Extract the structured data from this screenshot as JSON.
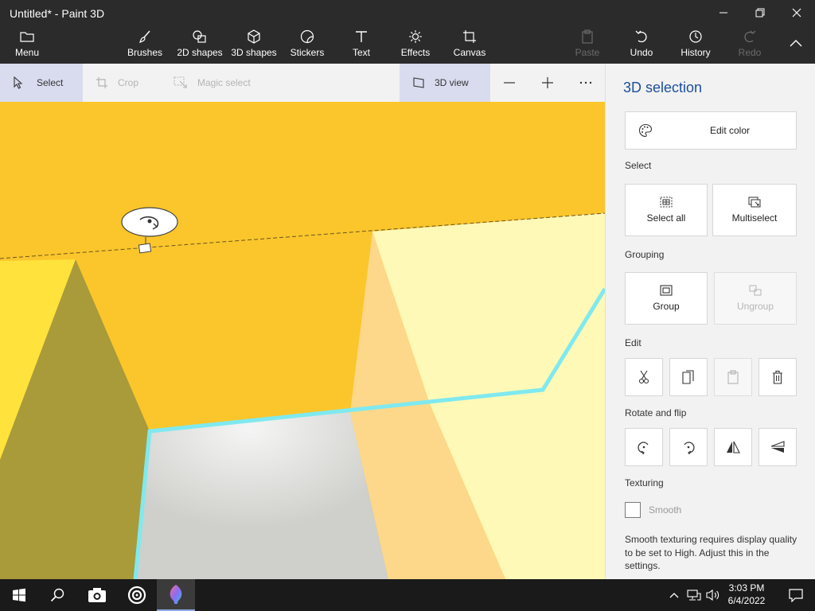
{
  "app": {
    "title": "Untitled* - Paint 3D"
  },
  "ribbon": {
    "menu": "Menu",
    "items": [
      "Brushes",
      "2D shapes",
      "3D shapes",
      "Stickers",
      "Text",
      "Effects",
      "Canvas"
    ],
    "right": [
      "Paste",
      "Undo",
      "History",
      "Redo"
    ]
  },
  "toolbar": {
    "select": "Select",
    "crop": "Crop",
    "magic_select": "Magic select",
    "view_3d": "3D view"
  },
  "panel": {
    "title": "3D selection",
    "edit_color": "Edit color",
    "select_label": "Select",
    "select_all": "Select all",
    "multiselect": "Multiselect",
    "grouping_label": "Grouping",
    "group": "Group",
    "ungroup": "Ungroup",
    "edit_label": "Edit",
    "rotate_label": "Rotate and flip",
    "texturing_label": "Texturing",
    "smooth": "Smooth",
    "note": "Smooth texturing requires display quality to be set to High. Adjust this in the settings."
  },
  "taskbar": {
    "time": "3:03 PM",
    "date": "6/4/2022"
  },
  "colors": {
    "accent": "#1c4f9c",
    "canvas_orange": "#fbc62b",
    "canvas_light_yellow": "#fff9b7",
    "selection_outline": "#7fe9ef"
  }
}
